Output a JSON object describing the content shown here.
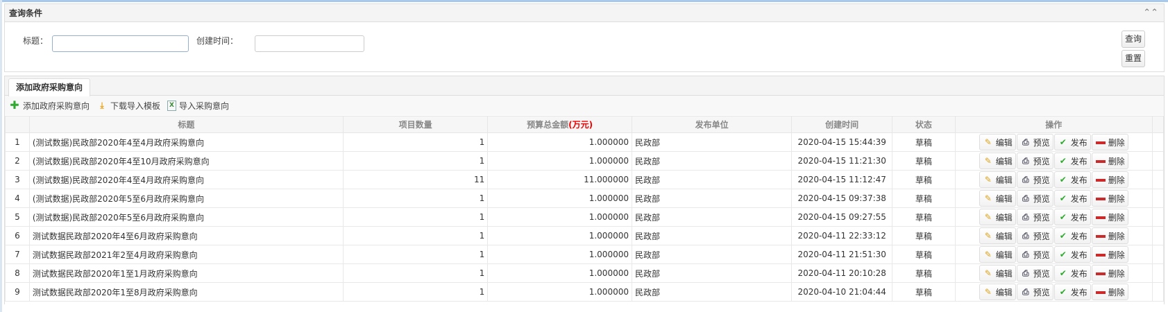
{
  "query": {
    "title": "查询条件",
    "title_label": "标题：",
    "title_value": "",
    "time_label": "创建时间：",
    "time_value": "",
    "search": "查询",
    "reset": "重置"
  },
  "tab": "添加政府采购意向",
  "toolbar": {
    "add": "添加政府采购意向",
    "download": "下载导入模板",
    "import": "导入采购意向"
  },
  "headers": {
    "title": "标题",
    "qty": "项目数量",
    "budget": "预算总金额",
    "budget_unit": "(万元)",
    "unit": "发布单位",
    "time": "创建时间",
    "status": "状态",
    "ops": "操作"
  },
  "actions": {
    "edit": "编辑",
    "preview": "预览",
    "publish": "发布",
    "delete": "删除"
  },
  "colors": {
    "accent": "#a8c8ec",
    "budget_unit": "#e00000",
    "publish": "#2eaa2e",
    "delete": "#cc2a2a"
  },
  "rows": [
    {
      "n": "1",
      "title": "(测试数据)民政部2020年4至4月政府采购意向",
      "qty": "1",
      "budget": "1.000000",
      "unit": "民政部",
      "time": "2020-04-15 15:44:39",
      "status": "草稿"
    },
    {
      "n": "2",
      "title": "(测试数据)民政部2020年4至10月政府采购意向",
      "qty": "1",
      "budget": "1.000000",
      "unit": "民政部",
      "time": "2020-04-15 11:21:30",
      "status": "草稿"
    },
    {
      "n": "3",
      "title": "(测试数据)民政部2020年4至4月政府采购意向",
      "qty": "11",
      "budget": "11.000000",
      "unit": "民政部",
      "time": "2020-04-15 11:12:47",
      "status": "草稿"
    },
    {
      "n": "4",
      "title": "(测试数据)民政部2020年5至6月政府采购意向",
      "qty": "1",
      "budget": "1.000000",
      "unit": "民政部",
      "time": "2020-04-15 09:37:38",
      "status": "草稿"
    },
    {
      "n": "5",
      "title": "(测试数据)民政部2020年5至6月政府采购意向",
      "qty": "1",
      "budget": "1.000000",
      "unit": "民政部",
      "time": "2020-04-15 09:27:55",
      "status": "草稿"
    },
    {
      "n": "6",
      "title": "测试数据民政部2020年4至6月政府采购意向",
      "qty": "1",
      "budget": "1.000000",
      "unit": "民政部",
      "time": "2020-04-11 22:33:12",
      "status": "草稿"
    },
    {
      "n": "7",
      "title": "测试数据民政部2021年2至4月政府采购意向",
      "qty": "1",
      "budget": "1.000000",
      "unit": "民政部",
      "time": "2020-04-11 21:51:30",
      "status": "草稿"
    },
    {
      "n": "8",
      "title": "测试数据民政部2020年1至1月政府采购意向",
      "qty": "1",
      "budget": "1.000000",
      "unit": "民政部",
      "time": "2020-04-11 20:10:28",
      "status": "草稿"
    },
    {
      "n": "9",
      "title": "测试数据民政部2020年1至8月政府采购意向",
      "qty": "1",
      "budget": "1.000000",
      "unit": "民政部",
      "time": "2020-04-10 21:04:44",
      "status": "草稿"
    }
  ]
}
